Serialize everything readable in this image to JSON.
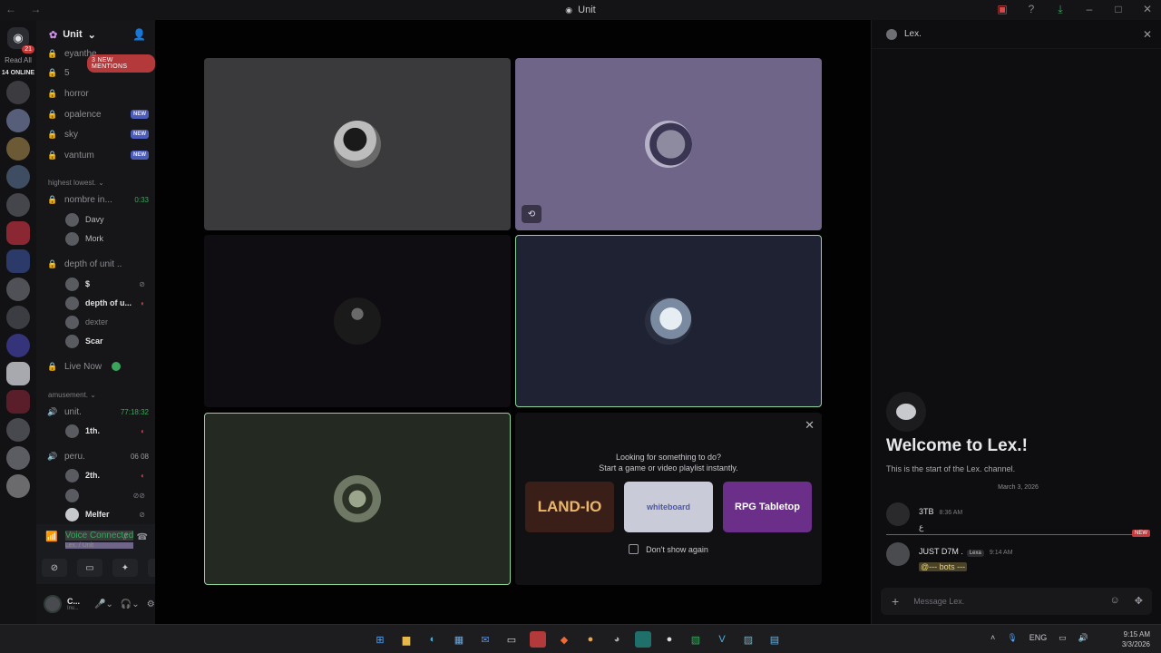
{
  "window": {
    "title": "Unit",
    "nav": "← →"
  },
  "servers": {
    "badge": "21",
    "read_all": "Read All",
    "online": "14 ONLINE"
  },
  "guild": {
    "name": "Unit",
    "mentions": "3 NEW MENTIONS"
  },
  "channels": {
    "top": [
      {
        "name": "eyanthe"
      },
      {
        "name": "5"
      },
      {
        "name": "horror"
      },
      {
        "name": "opalence",
        "badge": "NEW"
      },
      {
        "name": "sky",
        "badge": "NEW"
      },
      {
        "name": "vantum",
        "badge": "NEW"
      }
    ],
    "cat1": "highest lowest.",
    "vc1": {
      "name": "nombre in...",
      "time": "0:33",
      "members": [
        "Davy",
        "Mork"
      ]
    },
    "vc2": {
      "name": "depth of unit ..",
      "members": [
        "$",
        "depth of u...",
        "dexter",
        "Scar"
      ]
    },
    "live": "Live Now",
    "cat2": "amusement.",
    "vc3": {
      "name": "unit.",
      "time": "77:18:32",
      "members": [
        "1th."
      ]
    },
    "vc4": {
      "name": "peru.",
      "counts": "06  08",
      "members": [
        "2th.",
        "",
        "Melfer"
      ]
    }
  },
  "voice": {
    "status": "Voice Connected",
    "location": "Lex. / Unit"
  },
  "user": {
    "name": "C...",
    "status": "Inv..."
  },
  "activity": {
    "line1": "Looking for something to do?",
    "line2": "Start a game or video playlist instantly.",
    "cards": [
      "LAND-IO",
      "whiteboard",
      "RPG Tabletop"
    ],
    "dont_show": "Don't show again"
  },
  "chat": {
    "channel": "Lex.",
    "welcome_title": "Welcome to Lex.!",
    "welcome_sub": "This is the start of the Lex. channel.",
    "date": "March 3, 2026",
    "new_label": "NEW",
    "messages": [
      {
        "author": "3TB",
        "time": "8:36 AM",
        "text": "ع"
      },
      {
        "author": "JUST D7M .",
        "tag": "Lexa",
        "time": "9:14 AM",
        "text": "@--- bots ---"
      }
    ],
    "placeholder": "Message Lex."
  },
  "tray": {
    "lang": "ENG",
    "time": "9:15 AM",
    "date": "3/3/2026"
  },
  "colors": {
    "speaking_border": "#8fd49a",
    "connected": "#3ba55c",
    "mention_red": "#b4393b"
  }
}
